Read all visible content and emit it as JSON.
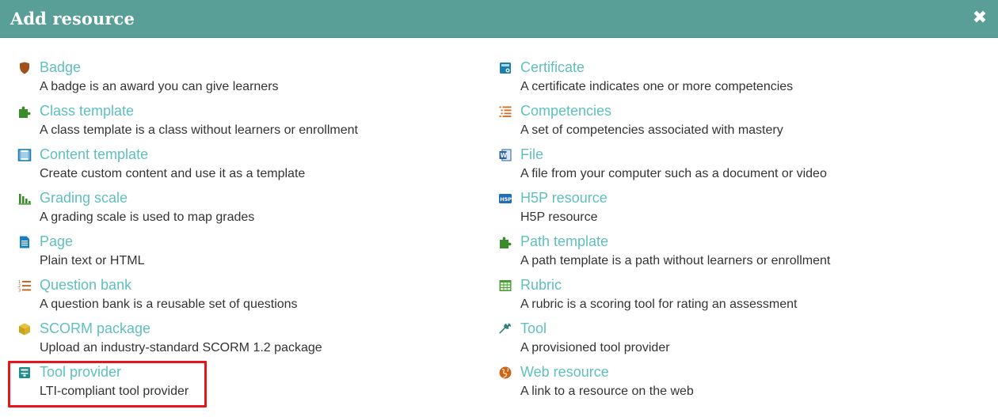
{
  "header": {
    "title": "Add resource",
    "close_glyph": "✖"
  },
  "left": [
    {
      "title": "Badge",
      "desc": "A badge is an award you can give learners",
      "icon": "shield-icon"
    },
    {
      "title": "Class template",
      "desc": "A class template is a class without learners or enrollment",
      "icon": "puzzle-icon"
    },
    {
      "title": "Content template",
      "desc": "Create custom content and use it as a template",
      "icon": "film-icon"
    },
    {
      "title": "Grading scale",
      "desc": "A grading scale is used to map grades",
      "icon": "bar-chart-icon"
    },
    {
      "title": "Page",
      "desc": "Plain text or HTML",
      "icon": "document-icon"
    },
    {
      "title": "Question bank",
      "desc": "A question bank is a reusable set of questions",
      "icon": "numbered-list-icon"
    },
    {
      "title": "SCORM package",
      "desc": "Upload an industry-standard SCORM 1.2 package",
      "icon": "package-icon"
    },
    {
      "title": "Tool provider",
      "desc": "LTI-compliant tool provider",
      "icon": "toolbox-icon"
    }
  ],
  "right": [
    {
      "title": "Certificate",
      "desc": "A certificate indicates one or more competencies",
      "icon": "certificate-icon"
    },
    {
      "title": "Competencies",
      "desc": "A set of competencies associated with mastery",
      "icon": "list-icon"
    },
    {
      "title": "File",
      "desc": "A file from your computer such as a document or video",
      "icon": "word-file-icon"
    },
    {
      "title": "H5P resource",
      "desc": "H5P resource",
      "icon": "h5p-icon",
      "icon_text": "H5P"
    },
    {
      "title": "Path template",
      "desc": "A path template is a path without learners or enrollment",
      "icon": "puzzle-icon"
    },
    {
      "title": "Rubric",
      "desc": "A rubric is a scoring tool for rating an assessment",
      "icon": "grid-table-icon"
    },
    {
      "title": "Tool",
      "desc": "A provisioned tool provider",
      "icon": "wrench-icon"
    },
    {
      "title": "Web resource",
      "desc": "A link to a resource on the web",
      "icon": "globe-icon"
    }
  ],
  "colors": {
    "header_bg": "#5a9f97",
    "link": "#5fbfbf",
    "desc": "#333333",
    "highlight": "#e8141b"
  }
}
